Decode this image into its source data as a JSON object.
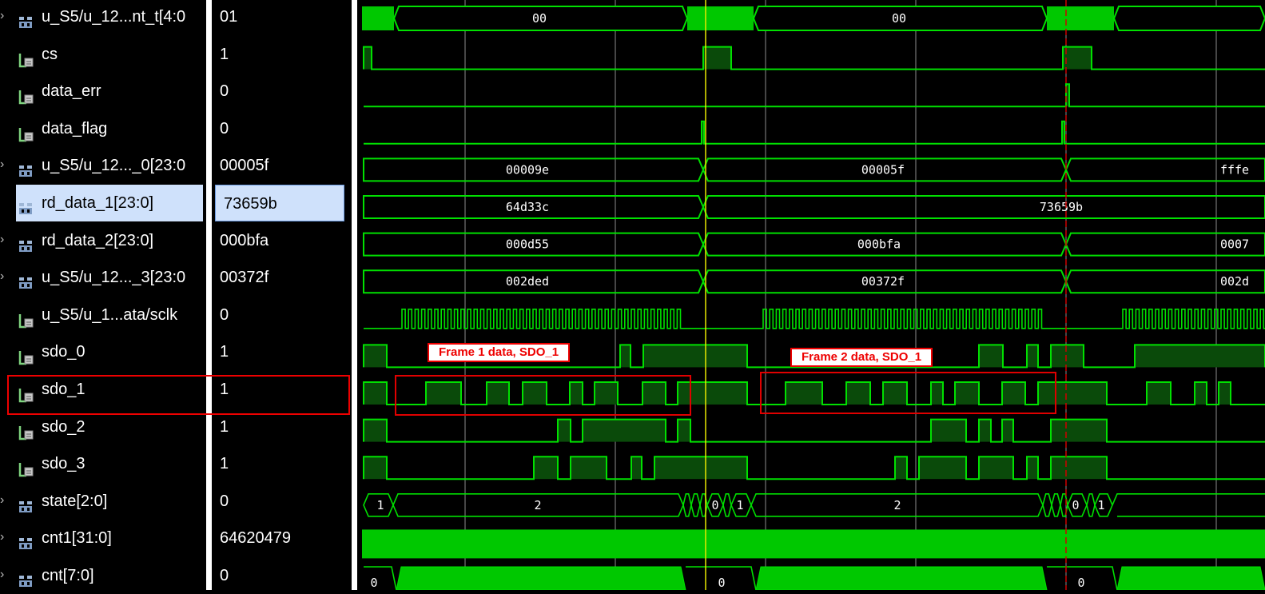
{
  "signals": [
    {
      "id": "bus5",
      "name": "u_S5/u_12...nt_t[4:0",
      "value": "01",
      "kind": "bus",
      "expandable": true
    },
    {
      "id": "cs",
      "name": "cs",
      "value": "1",
      "kind": "bit"
    },
    {
      "id": "data_err",
      "name": "data_err",
      "value": "0",
      "kind": "bit"
    },
    {
      "id": "data_flag",
      "name": "data_flag",
      "value": "0",
      "kind": "bit"
    },
    {
      "id": "bus24a",
      "name": "u_S5/u_12..._0[23:0",
      "value": "00005f",
      "kind": "bus",
      "expandable": true
    },
    {
      "id": "rd1",
      "name": "rd_data_1[23:0]",
      "value": "73659b",
      "kind": "bus",
      "expandable": true,
      "selected": true
    },
    {
      "id": "rd2",
      "name": "rd_data_2[23:0]",
      "value": "000bfa",
      "kind": "bus",
      "expandable": true
    },
    {
      "id": "bus24c",
      "name": "u_S5/u_12..._3[23:0",
      "value": "00372f",
      "kind": "bus",
      "expandable": true
    },
    {
      "id": "sclk",
      "name": "u_S5/u_1...ata/sclk",
      "value": "0",
      "kind": "bit"
    },
    {
      "id": "sdo0",
      "name": "sdo_0",
      "value": "1",
      "kind": "bit"
    },
    {
      "id": "sdo1",
      "name": "sdo_1",
      "value": "1",
      "kind": "bit"
    },
    {
      "id": "sdo2",
      "name": "sdo_2",
      "value": "1",
      "kind": "bit"
    },
    {
      "id": "sdo3",
      "name": "sdo_3",
      "value": "1",
      "kind": "bit"
    },
    {
      "id": "state",
      "name": "state[2:0]",
      "value": "0",
      "kind": "bus",
      "expandable": true
    },
    {
      "id": "cnt1",
      "name": "cnt1[31:0]",
      "value": "64620479",
      "kind": "bus",
      "expandable": true
    },
    {
      "id": "cnt",
      "name": "cnt[7:0]",
      "value": "0",
      "kind": "bus",
      "expandable": true
    }
  ],
  "waveforms": {
    "bus5": {
      "segments": [
        {
          "v": "",
          "solid": true
        },
        {
          "v": "00"
        },
        {
          "v": "",
          "solid": true
        },
        {
          "v": "00"
        },
        {
          "v": "",
          "solid": true
        },
        {
          "v": ""
        }
      ]
    },
    "bus24a": {
      "labels": [
        "00009e",
        "00005f",
        "fffe"
      ]
    },
    "rd1": {
      "labels": [
        "64d33c",
        "73659b"
      ]
    },
    "rd2": {
      "labels": [
        "000d55",
        "000bfa",
        "0007"
      ]
    },
    "bus24c": {
      "labels": [
        "002ded",
        "00372f",
        "002d"
      ]
    },
    "state": {
      "labels": [
        "1",
        "2",
        "0",
        "1",
        "2",
        "0",
        "1"
      ]
    },
    "cnt": {
      "labels": [
        "0",
        "0",
        "0"
      ]
    }
  },
  "annotations": {
    "frame1": "Frame 1 data, SDO_1",
    "frame2": "Frame 2 data, SDO_1"
  },
  "colors": {
    "wave": "#00e000",
    "fill": "#0a4a0a",
    "grid": "#8c8c8c",
    "cursor": "#e8e800",
    "marker": "#d00000",
    "highlight": "#e00000"
  }
}
